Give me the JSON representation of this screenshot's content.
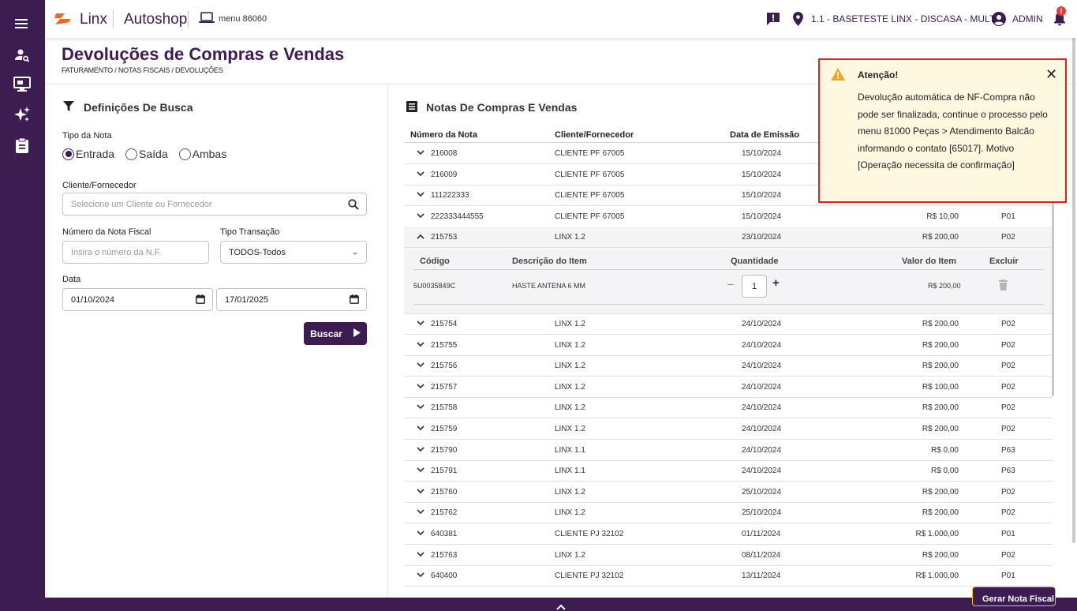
{
  "header": {
    "brand": "Linx",
    "product": "Autoshop",
    "menu_code": "menu 86060",
    "store": "1.1 - BASETESTE LINX - DISCASA - MULT",
    "user": "ADMIN",
    "notification_badge": "!"
  },
  "page": {
    "title": "Devoluções de Compras e Vendas",
    "breadcrumb": "FATURAMENTO / NOTAS FISCAIS / DEVOLUÇÕES"
  },
  "search": {
    "title": "Definições De Busca",
    "tipo_nota_label": "Tipo da Nota",
    "tipo_nota_options": [
      "Entrada",
      "Saída",
      "Ambas"
    ],
    "tipo_nota_selected": "Entrada",
    "cliente_label": "Cliente/Fornecedor",
    "cliente_placeholder": "Selecione um Cliente ou Fornecedor",
    "nf_label": "Número da Nota Fiscal",
    "nf_placeholder": "Insira o número da N.F.",
    "transacao_label": "Tipo Transação",
    "transacao_value": "TODOS-Todos",
    "data_label": "Data",
    "data_inicio": "01/10/2024",
    "data_fim": "17/01/2025",
    "buscar_label": "Buscar"
  },
  "notes": {
    "title": "Notas De Compras E Vendas",
    "columns": [
      "Número da Nota",
      "Cliente/Fornecedor",
      "Data de Emissão"
    ],
    "rows_before": [
      {
        "numero": "216008",
        "cliente": "CLIENTE PF 67005",
        "data": "15/10/2024",
        "valor": "",
        "serie": ""
      },
      {
        "numero": "216009",
        "cliente": "CLIENTE PF 67005",
        "data": "15/10/2024",
        "valor": "",
        "serie": ""
      },
      {
        "numero": "111222333",
        "cliente": "CLIENTE PF 67005",
        "data": "15/10/2024",
        "valor": "",
        "serie": ""
      },
      {
        "numero": "222333444555",
        "cliente": "CLIENTE PF 67005",
        "data": "15/10/2024",
        "valor": "R$ 10,00",
        "serie": "P01"
      },
      {
        "numero": "215753",
        "cliente": "LINX 1.2",
        "data": "23/10/2024",
        "valor": "R$ 200,00",
        "serie": "P02"
      }
    ],
    "detail": {
      "columns": [
        "Código",
        "Descrição do Item",
        "Quantidade",
        "Valor do Item",
        "Excluir"
      ],
      "item": {
        "codigo": "5U0035849C",
        "descricao": "HASTE ANTENA 6 MM",
        "quantidade": "1",
        "valor": "R$ 200,00"
      }
    },
    "rows_after": [
      {
        "numero": "215754",
        "cliente": "LINX 1.2",
        "data": "24/10/2024",
        "valor": "R$ 200,00",
        "serie": "P02"
      },
      {
        "numero": "215755",
        "cliente": "LINX 1.2",
        "data": "24/10/2024",
        "valor": "R$ 200,00",
        "serie": "P02"
      },
      {
        "numero": "215756",
        "cliente": "LINX 1.2",
        "data": "24/10/2024",
        "valor": "R$ 200,00",
        "serie": "P02"
      },
      {
        "numero": "215757",
        "cliente": "LINX 1.2",
        "data": "24/10/2024",
        "valor": "R$ 100,00",
        "serie": "P02"
      },
      {
        "numero": "215758",
        "cliente": "LINX 1.2",
        "data": "24/10/2024",
        "valor": "R$ 200,00",
        "serie": "P02"
      },
      {
        "numero": "215759",
        "cliente": "LINX 1.2",
        "data": "24/10/2024",
        "valor": "R$ 200,00",
        "serie": "P02"
      },
      {
        "numero": "215790",
        "cliente": "LINX 1.1",
        "data": "24/10/2024",
        "valor": "R$ 0,00",
        "serie": "P63"
      },
      {
        "numero": "215791",
        "cliente": "LINX 1.1",
        "data": "24/10/2024",
        "valor": "R$ 0,00",
        "serie": "P63"
      },
      {
        "numero": "215760",
        "cliente": "LINX 1.2",
        "data": "25/10/2024",
        "valor": "R$ 200,00",
        "serie": "P02"
      },
      {
        "numero": "215762",
        "cliente": "LINX 1.2",
        "data": "25/10/2024",
        "valor": "R$ 200,00",
        "serie": "P02"
      },
      {
        "numero": "640381",
        "cliente": "CLIENTE PJ 32102",
        "data": "01/11/2024",
        "valor": "R$ 1.000,00",
        "serie": "P01"
      },
      {
        "numero": "215763",
        "cliente": "LINX 1.2",
        "data": "08/11/2024",
        "valor": "R$ 200,00",
        "serie": "P02"
      },
      {
        "numero": "640400",
        "cliente": "CLIENTE PJ 32102",
        "data": "13/11/2024",
        "valor": "R$ 1.000,00",
        "serie": "P01"
      }
    ],
    "gerar_label": "Gerar Nota Fiscal"
  },
  "alert": {
    "title": "Atenção!",
    "message": "Devolução automática de NF-Compra não pode ser finalizada, continue o processo pelo menu 81000 Peças > Atendimento Balcão informando o contato [65017]. Motivo [Operação necessita de confirmação]"
  },
  "colors": {
    "primary": "#3d1c52",
    "accent_logo": "#f26722",
    "alert_border": "#e01f1f",
    "alert_bg": "#fff8e1",
    "warning": "#f5a623"
  }
}
